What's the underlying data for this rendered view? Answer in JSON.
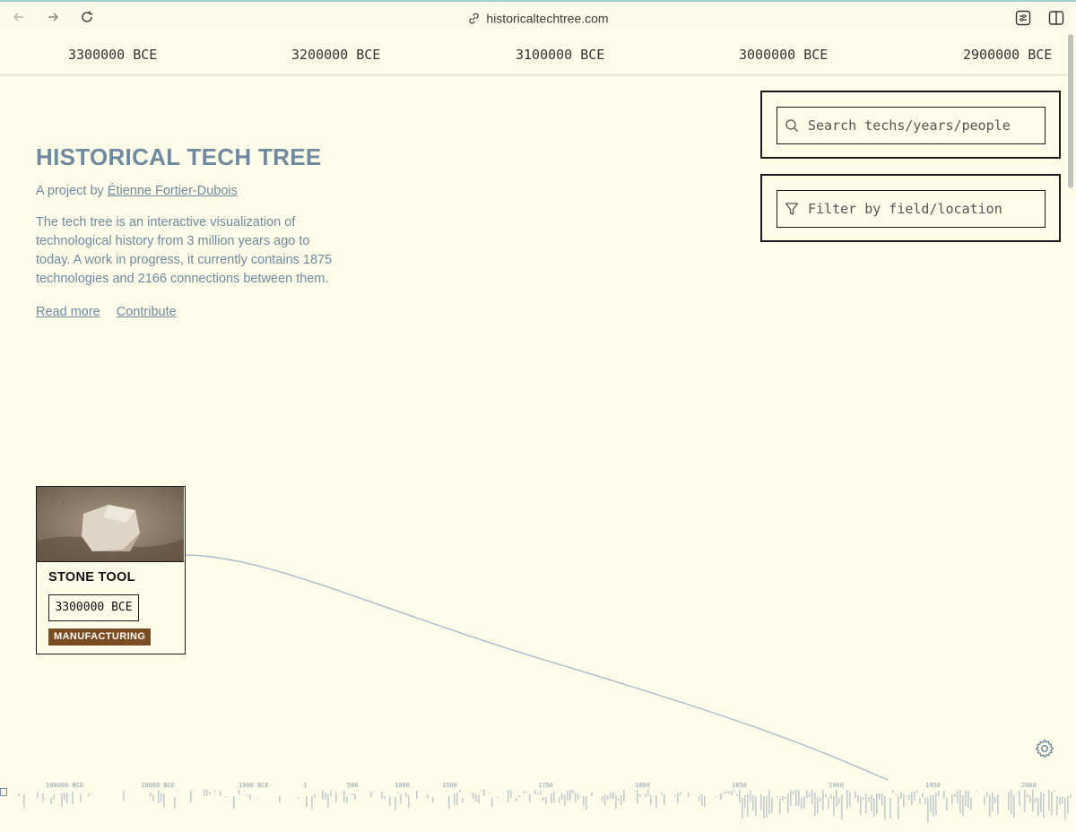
{
  "browser": {
    "url": "historicaltechtree.com",
    "back_icon": "arrow-left-icon",
    "forward_icon": "arrow-right-icon",
    "reload_icon": "reload-icon",
    "link_icon": "link-icon",
    "settings_icon": "sliders-icon",
    "sidebar_icon": "sidebar-icon"
  },
  "timeline_header": {
    "years": [
      "3300000 BCE",
      "3200000 BCE",
      "3100000 BCE",
      "3000000 BCE",
      "2900000 BCE"
    ]
  },
  "intro": {
    "title": "HISTORICAL TECH TREE",
    "byline_prefix": "A project by ",
    "author": "Étienne Fortier-Dubois",
    "description": "The tech tree is an interactive visualization of technological history from 3 million years ago to today. A work in progress, it currently contains 1875 technologies and 2166 connections between them.",
    "read_more": "Read more",
    "contribute": "Contribute"
  },
  "search": {
    "placeholder": "Search techs/years/people",
    "icon": "search-icon"
  },
  "filter": {
    "placeholder": "Filter by field/location",
    "icon": "filter-icon"
  },
  "tech_card": {
    "title": "STONE TOOL",
    "year": "3300000 BCE",
    "tag": "MANUFACTURING",
    "tag_color": "#7a4c22"
  },
  "minimap": {
    "labels": [
      "100000 BCE",
      "10000 BCE",
      "1000 BCE",
      "1",
      "500",
      "1000",
      "1500",
      "1750",
      "1800",
      "1850",
      "1900",
      "1950",
      "2000"
    ]
  },
  "colors": {
    "background": "#fdfce8",
    "accent": "#6f8aa0",
    "connector": "#a9bccb"
  }
}
